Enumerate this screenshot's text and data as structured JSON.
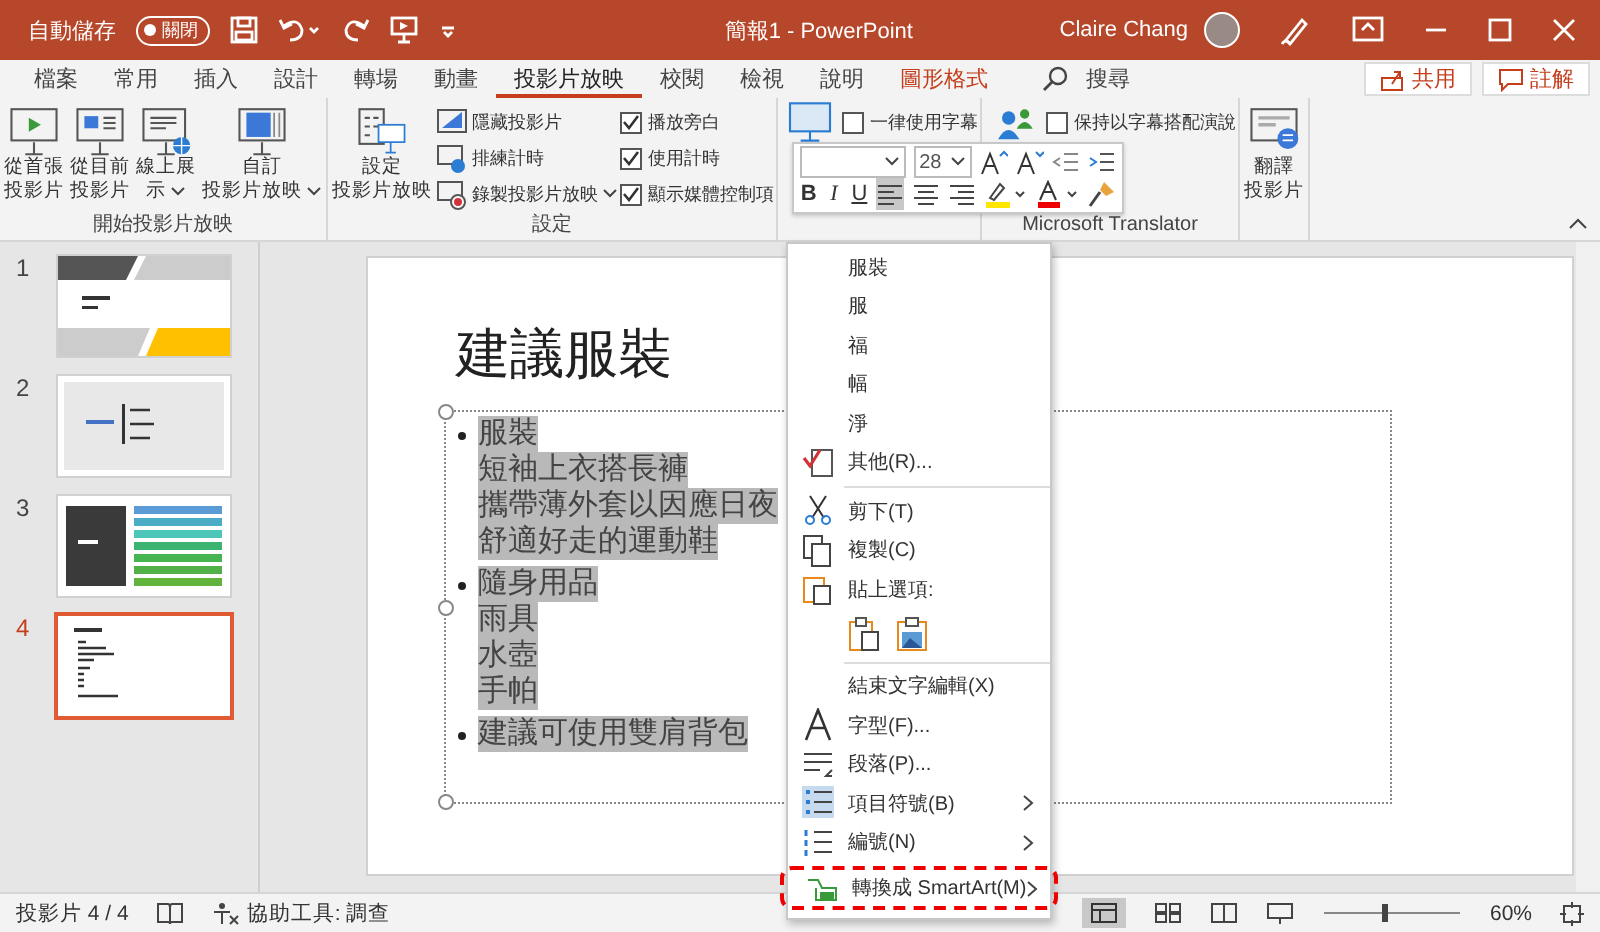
{
  "title_bar": {
    "autosave_label": "自動儲存",
    "autosave_toggle": "關閉",
    "autosave_on": false,
    "title": "簡報1 - PowerPoint",
    "user": "Claire Chang"
  },
  "tabs": [
    {
      "label": "檔案",
      "selected": false,
      "kind": "normal"
    },
    {
      "label": "常用",
      "selected": false,
      "kind": "normal"
    },
    {
      "label": "插入",
      "selected": false,
      "kind": "normal"
    },
    {
      "label": "設計",
      "selected": false,
      "kind": "normal"
    },
    {
      "label": "轉場",
      "selected": false,
      "kind": "normal"
    },
    {
      "label": "動畫",
      "selected": false,
      "kind": "normal"
    },
    {
      "label": "投影片放映",
      "selected": true,
      "kind": "normal"
    },
    {
      "label": "校閱",
      "selected": false,
      "kind": "normal"
    },
    {
      "label": "檢視",
      "selected": false,
      "kind": "normal"
    },
    {
      "label": "說明",
      "selected": false,
      "kind": "normal"
    },
    {
      "label": "圖形格式",
      "selected": false,
      "kind": "contextual"
    }
  ],
  "search_label": "搜尋",
  "share_button": "共用",
  "comments_button": "註解",
  "ribbon": [
    {
      "caption": "開始投影片放映",
      "items": [
        {
          "kind": "large",
          "label": "從首張投影片"
        },
        {
          "kind": "large",
          "label": "從目前投影片"
        },
        {
          "kind": "large",
          "label": "線上展示",
          "dropdown": true
        },
        {
          "kind": "large",
          "label": "自訂投影片放映",
          "dropdown": true
        }
      ]
    },
    {
      "caption": "設定",
      "items": [
        {
          "kind": "large",
          "label": "設定投影片放映"
        },
        {
          "kind": "small",
          "label": "隱藏投影片"
        },
        {
          "kind": "small",
          "label": "排練計時"
        },
        {
          "kind": "small",
          "label": "錄製投影片放映",
          "dropdown": true
        },
        {
          "kind": "check",
          "label": "播放旁白",
          "checked": true
        },
        {
          "kind": "check",
          "label": "使用計時",
          "checked": true
        },
        {
          "kind": "check",
          "label": "顯示媒體控制項",
          "checked": true
        }
      ]
    },
    {
      "items": [
        {
          "kind": "large"
        },
        {
          "kind": "check",
          "label": "一律使用字幕",
          "checked": false
        }
      ]
    },
    {
      "caption": "Microsoft Translator",
      "items": [
        {
          "kind": "large"
        },
        {
          "kind": "check",
          "label": "保持以字幕搭配演說",
          "checked": false
        }
      ]
    },
    {
      "items": [
        {
          "kind": "large",
          "label": "翻譯投影片"
        }
      ]
    }
  ],
  "mini_toolbar": {
    "font_size": "28",
    "format_buttons": [
      "B",
      "I",
      "U"
    ],
    "align": [
      {
        "selected": true
      },
      {
        "selected": false
      },
      {
        "selected": false
      }
    ]
  },
  "thumbnails": [
    {
      "number": "1",
      "selected": false
    },
    {
      "number": "2",
      "selected": false
    },
    {
      "number": "3",
      "selected": false
    },
    {
      "number": "4",
      "selected": true
    }
  ],
  "slide": {
    "title": "建議服裝",
    "text_selected": true,
    "bullets": [
      {
        "lines": [
          "服裝",
          "短袖上衣搭長褲",
          "攜帶薄外套以因應日夜",
          "舒適好走的運動鞋"
        ]
      },
      {
        "lines": [
          "隨身用品",
          "雨具",
          "水壺",
          "手帕"
        ]
      },
      {
        "lines": [
          "建議可使用雙肩背包"
        ]
      }
    ]
  },
  "context_menu": [
    {
      "kind": "suggestion",
      "label": "服裝"
    },
    {
      "kind": "suggestion",
      "label": "服"
    },
    {
      "kind": "suggestion",
      "label": "福"
    },
    {
      "kind": "suggestion",
      "label": "幅"
    },
    {
      "kind": "suggestion",
      "label": "淨"
    },
    {
      "kind": "command",
      "label": "其他(R)..."
    },
    {
      "kind": "separator"
    },
    {
      "kind": "command",
      "label": "剪下(T)"
    },
    {
      "kind": "command",
      "label": "複製(C)"
    },
    {
      "kind": "command",
      "label": "貼上選項:"
    },
    {
      "kind": "paste_options"
    },
    {
      "kind": "separator"
    },
    {
      "kind": "suggestion",
      "label": "結束文字編輯(X)"
    },
    {
      "kind": "command",
      "label": "字型(F)..."
    },
    {
      "kind": "command",
      "label": "段落(P)..."
    },
    {
      "kind": "command",
      "label": "項目符號(B)",
      "submenu": true
    },
    {
      "kind": "command",
      "label": "編號(N)",
      "submenu": true
    },
    {
      "kind": "command",
      "label": "轉換成 SmartArt(M)",
      "submenu": true,
      "highlighted": true
    }
  ],
  "status_bar": {
    "slide_count": "投影片 4 / 4",
    "accessibility": "協助工具: 調查",
    "zoom": "60%"
  }
}
